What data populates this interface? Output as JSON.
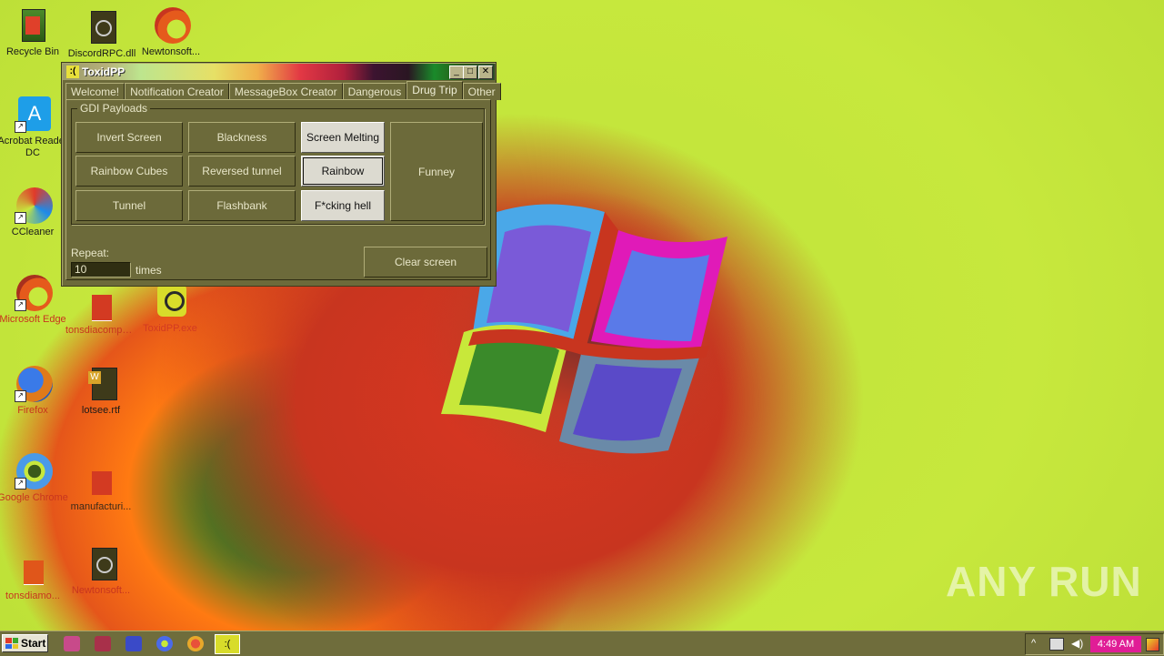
{
  "desktop": {
    "icons": [
      {
        "label": "Recycle Bin"
      },
      {
        "label": "DiscordRPC.dll"
      },
      {
        "label": "Newtonsoft..."
      },
      {
        "label": "Acrobat Reader DC"
      },
      {
        "label": "CCleaner"
      },
      {
        "label": "Microsoft Edge"
      },
      {
        "label": "tonsdiacompan..."
      },
      {
        "label": "ToxidPP.exe"
      },
      {
        "label": "Firefox"
      },
      {
        "label": "lotsee.rtf"
      },
      {
        "label": "Google Chrome"
      },
      {
        "label": "manufacturi..."
      },
      {
        "label": "tonsdiamo..."
      },
      {
        "label": "Newtonsoft..."
      }
    ]
  },
  "window": {
    "title": "ToxidPP",
    "app_icon": ":(",
    "tabs": [
      {
        "label": "Welcome!"
      },
      {
        "label": "Notification Creator"
      },
      {
        "label": "MessageBox Creator"
      },
      {
        "label": "Dangerous"
      },
      {
        "label": "Drug Trip"
      },
      {
        "label": "Other"
      }
    ],
    "active_tab": "Drug Trip",
    "group_title": "GDI Payloads",
    "buttons": {
      "invert_screen": "Invert Screen",
      "blackness": "Blackness",
      "screen_melting": "Screen Melting",
      "rainbow_cubes": "Rainbow Cubes",
      "reversed_tunnel": "Reversed tunnel",
      "rainbow": "Rainbow",
      "tunnel": "Tunnel",
      "flashbank": "Flashbank",
      "fcking_hell": "F*cking hell",
      "funney": "Funney",
      "clear_screen": "Clear screen"
    },
    "repeat_label": "Repeat:",
    "repeat_value": "10",
    "times_label": "times"
  },
  "taskbar": {
    "start_label": "Start",
    "clock": "4:49 AM"
  },
  "watermark": "ANY RUN"
}
